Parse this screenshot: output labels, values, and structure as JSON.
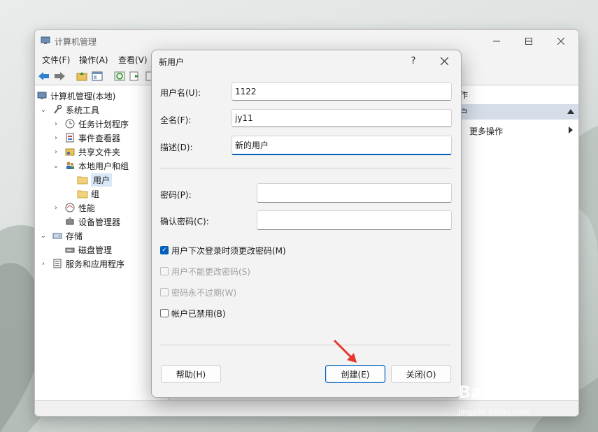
{
  "main_window": {
    "title": "计算机管理",
    "menu": [
      "文件(F)",
      "操作(A)",
      "查看(V)"
    ]
  },
  "tree": [
    {
      "label": "计算机管理(本地)",
      "icon": "computer-management-icon"
    },
    {
      "label": "系统工具",
      "icon": "system-tools-icon"
    },
    {
      "label": "任务计划程序",
      "icon": "clock-icon"
    },
    {
      "label": "事件查看器",
      "icon": "event-viewer-icon"
    },
    {
      "label": "共享文件夹",
      "icon": "shared-folder-icon"
    },
    {
      "label": "本地用户和组",
      "icon": "users-icon"
    },
    {
      "label": "用户",
      "icon": "folder-icon"
    },
    {
      "label": "组",
      "icon": "folder-icon"
    },
    {
      "label": "性能",
      "icon": "performance-icon"
    },
    {
      "label": "设备管理器",
      "icon": "device-manager-icon"
    },
    {
      "label": "存储",
      "icon": "storage-icon"
    },
    {
      "label": "磁盘管理",
      "icon": "disk-icon"
    },
    {
      "label": "服务和应用程序",
      "icon": "services-icon"
    }
  ],
  "actions": {
    "header": "作",
    "section": "户",
    "more": "更多操作"
  },
  "dialog": {
    "title": "新用户",
    "help": "?",
    "username_label": "用户名(U):",
    "username_value": "1122",
    "fullname_label": "全名(F):",
    "fullname_value": "jy11",
    "description_label": "描述(D):",
    "description_value": "新的用户",
    "password_label": "密码(P):",
    "password_value": "",
    "confirm_label": "确认密码(C):",
    "confirm_value": "",
    "checks": [
      {
        "label": "用户下次登录时须更改密码(M)",
        "checked": true,
        "disabled": false
      },
      {
        "label": "用户不能更改密码(S)",
        "checked": false,
        "disabled": true
      },
      {
        "label": "密码永不过期(W)",
        "checked": false,
        "disabled": true
      },
      {
        "label": "帐户已禁用(B)",
        "checked": false,
        "disabled": false
      }
    ],
    "help_button": "帮助(H)",
    "create_button": "创建(E)",
    "close_button": "关闭(O)"
  },
  "watermark": {
    "brand": "Bai经验",
    "url": "jingyan.baidu.com"
  },
  "colors": {
    "accent": "#005fb8",
    "arrow": "#e8362f"
  }
}
